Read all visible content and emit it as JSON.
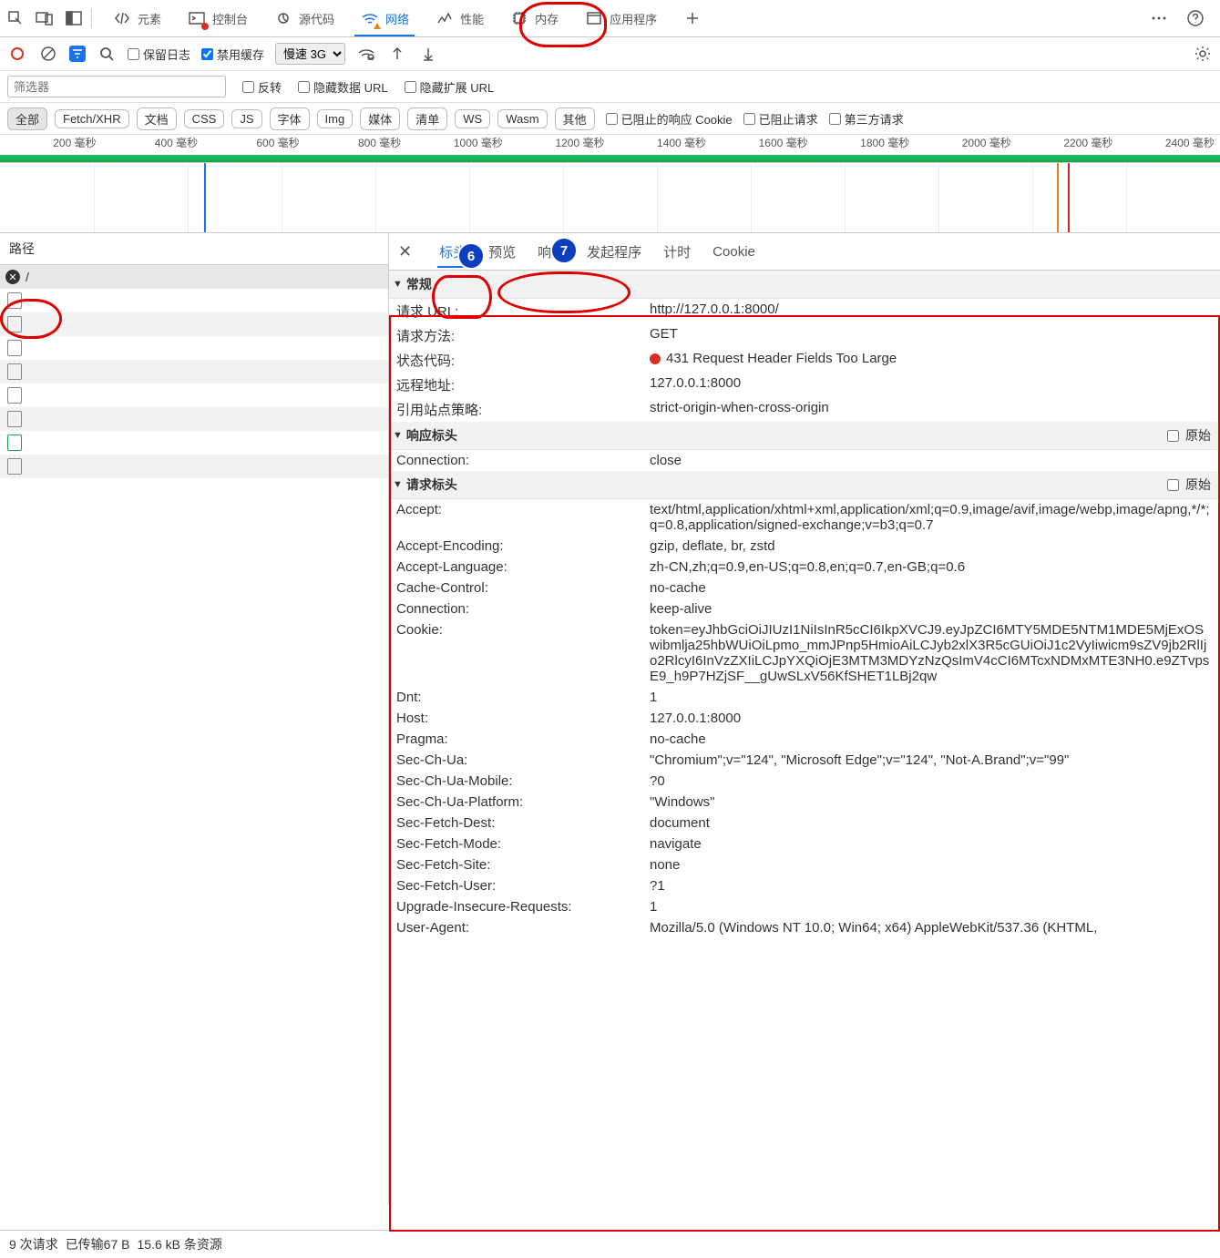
{
  "topTabs": {
    "elements": "元素",
    "console": "控制台",
    "sources": "源代码",
    "network": "网络",
    "performance": "性能",
    "memory": "内存",
    "application": "应用程序"
  },
  "toolbar": {
    "preserveLog": "保留日志",
    "disableCache": "禁用缓存",
    "throttle": "慢速 3G"
  },
  "filterRow": {
    "filterPh": "筛选器",
    "invert": "反转",
    "hideData": "隐藏数据 URL",
    "hideExt": "隐藏扩展 URL"
  },
  "types": {
    "all": "全部",
    "fetch": "Fetch/XHR",
    "doc": "文档",
    "css": "CSS",
    "js": "JS",
    "font": "字体",
    "img": "Img",
    "media": "媒体",
    "manifest": "清单",
    "ws": "WS",
    "wasm": "Wasm",
    "other": "其他"
  },
  "typeChecks": {
    "blockedCookie": "已阻止的响应 Cookie",
    "blockedReq": "已阻止请求",
    "thirdParty": "第三方请求"
  },
  "timeline": {
    "ticks": [
      "200 毫秒",
      "400 毫秒",
      "600 毫秒",
      "800 毫秒",
      "1000 毫秒",
      "1200 毫秒",
      "1400 毫秒",
      "1600 毫秒",
      "1800 毫秒",
      "2000 毫秒",
      "2200 毫秒",
      "2400 毫秒"
    ]
  },
  "leftPane": {
    "pathHdr": "路径",
    "rows": [
      {
        "name": "/",
        "err": true
      }
    ]
  },
  "detailTabs": {
    "headers": "标头",
    "preview": "预览",
    "response": "响应",
    "initiator": "发起程序",
    "timing": "计时",
    "cookies": "Cookie"
  },
  "general": {
    "title": "常规",
    "requestURL_k": "请求 URL:",
    "requestURL_v": "http://127.0.0.1:8000/",
    "method_k": "请求方法:",
    "method_v": "GET",
    "status_k": "状态代码:",
    "status_v": "431 Request Header Fields Too Large",
    "remote_k": "远程地址:",
    "remote_v": "127.0.0.1:8000",
    "referrer_k": "引用站点策略:",
    "referrer_v": "strict-origin-when-cross-origin"
  },
  "respHdr": {
    "title": "响应标头",
    "raw": "原始",
    "connection_k": "Connection:",
    "connection_v": "close"
  },
  "reqHdr": {
    "title": "请求标头",
    "raw": "原始",
    "items": [
      {
        "k": "Accept:",
        "v": "text/html,application/xhtml+xml,application/xml;q=0.9,image/avif,image/webp,image/apng,*/*;q=0.8,application/signed-exchange;v=b3;q=0.7"
      },
      {
        "k": "Accept-Encoding:",
        "v": "gzip, deflate, br, zstd"
      },
      {
        "k": "Accept-Language:",
        "v": "zh-CN,zh;q=0.9,en-US;q=0.8,en;q=0.7,en-GB;q=0.6"
      },
      {
        "k": "Cache-Control:",
        "v": "no-cache"
      },
      {
        "k": "Connection:",
        "v": "keep-alive"
      },
      {
        "k": "Cookie:",
        "v": "token=eyJhbGciOiJIUzI1NiIsInR5cCI6IkpXVCJ9.eyJpZCI6MTY5MDE5NTM1MDE5MjExOSwibmlja25hbWUiOiLpmo_mmJPnp5HmioAiLCJyb2xlX3R5cGUiOiJ1c2VyIiwicm9sZV9jb2RlIjo2RlcyI6InVzZXIiLCJpYXQiOjE3MTM3MDYzNzQsImV4cCI6MTcxNDMxMTE3NH0.e9ZTvpsE9_h9P7HZjSF__gUwSLxV56KfSHET1LBj2qw"
      },
      {
        "k": "Dnt:",
        "v": "1"
      },
      {
        "k": "Host:",
        "v": "127.0.0.1:8000"
      },
      {
        "k": "Pragma:",
        "v": "no-cache"
      },
      {
        "k": "Sec-Ch-Ua:",
        "v": "\"Chromium\";v=\"124\", \"Microsoft Edge\";v=\"124\", \"Not-A.Brand\";v=\"99\""
      },
      {
        "k": "Sec-Ch-Ua-Mobile:",
        "v": "?0"
      },
      {
        "k": "Sec-Ch-Ua-Platform:",
        "v": "\"Windows\""
      },
      {
        "k": "Sec-Fetch-Dest:",
        "v": "document"
      },
      {
        "k": "Sec-Fetch-Mode:",
        "v": "navigate"
      },
      {
        "k": "Sec-Fetch-Site:",
        "v": "none"
      },
      {
        "k": "Sec-Fetch-User:",
        "v": "?1"
      },
      {
        "k": "Upgrade-Insecure-Requests:",
        "v": "1"
      },
      {
        "k": "User-Agent:",
        "v": "Mozilla/5.0 (Windows NT 10.0; Win64; x64) AppleWebKit/537.36 (KHTML,"
      }
    ]
  },
  "statusBar": {
    "requests": "9 次请求",
    "transferred": "已传输67 B",
    "resources": "15.6 kB",
    "resLbl": "条资源"
  },
  "anno": {
    "six": "6",
    "seven": "7"
  }
}
